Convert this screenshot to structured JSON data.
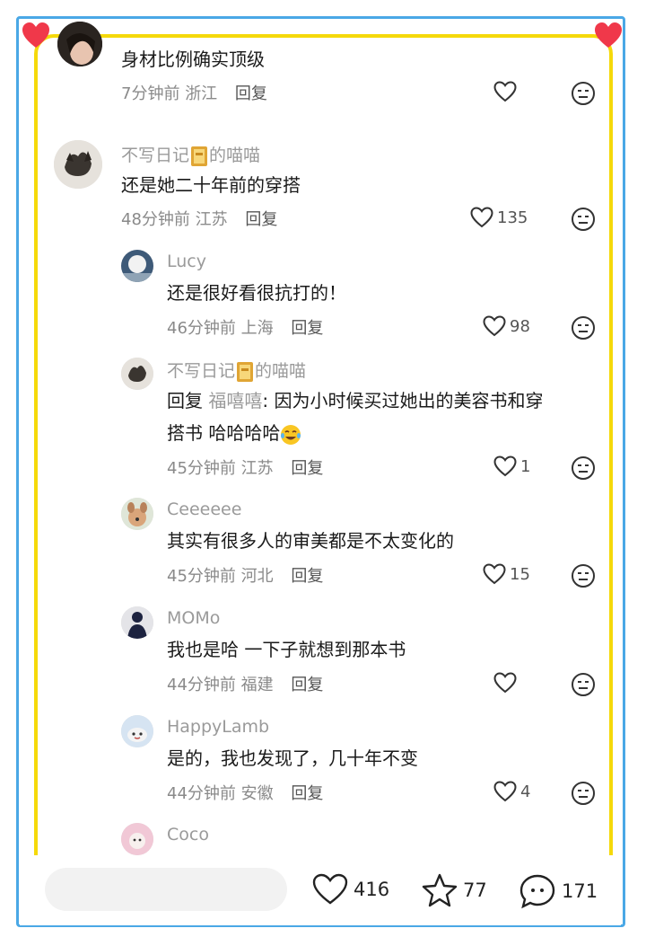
{
  "colors": {
    "frame_blue": "#4aa8e6",
    "frame_yellow": "#f5d90a",
    "heart_red": "#f0384a",
    "username_gray": "#9a9a9a",
    "text_dark": "#1a1a1a"
  },
  "comments": [
    {
      "avatar_icon": "avatar-girl-portrait",
      "username": "",
      "text_lines": [
        "身材比例确实顶级"
      ],
      "time": "7分钟前",
      "location": "浙江",
      "reply_label": "回复",
      "likes": ""
    },
    {
      "avatar_icon": "avatar-cat",
      "username_parts": [
        "不写日记",
        "的喵喵"
      ],
      "text_lines": [
        "还是她二十年前的穿搭"
      ],
      "time": "48分钟前",
      "location": "江苏",
      "reply_label": "回复",
      "likes": "135"
    }
  ],
  "replies": [
    {
      "avatar_icon": "avatar-moon",
      "username": "Lucy",
      "text_lines": [
        "还是很好看很抗打的！"
      ],
      "time": "46分钟前",
      "location": "上海",
      "reply_label": "回复",
      "likes": "98"
    },
    {
      "avatar_icon": "avatar-cat",
      "username_parts": [
        "不写日记",
        "的喵喵"
      ],
      "reply_prefix": "回复",
      "reply_to": "福嘻嘻",
      "text_line1_rest": ": 因为小时候买过她出的美容书和穿",
      "text_line2": "搭书 哈哈哈哈",
      "time": "45分钟前",
      "location": "江苏",
      "reply_label": "回复",
      "likes": "1"
    },
    {
      "avatar_icon": "avatar-dog",
      "username": "Ceeeeee",
      "text_lines": [
        "其实有很多人的审美都是不太变化的"
      ],
      "time": "45分钟前",
      "location": "河北",
      "reply_label": "回复",
      "likes": "15"
    },
    {
      "avatar_icon": "avatar-person-dark",
      "username": "MOMo",
      "text_lines": [
        "我也是哈 一下子就想到那本书"
      ],
      "time": "44分钟前",
      "location": "福建",
      "reply_label": "回复",
      "likes": ""
    },
    {
      "avatar_icon": "avatar-lamb",
      "username": "HappyLamb",
      "text_lines": [
        "是的，我也发现了，几十年不变"
      ],
      "time": "44分钟前",
      "location": "安徽",
      "reply_label": "回复",
      "likes": "4"
    },
    {
      "avatar_icon": "avatar-pink-pet",
      "username": "Coco"
    }
  ],
  "bottom_bar": {
    "likes": "416",
    "favorites": "77",
    "comments": "171"
  }
}
